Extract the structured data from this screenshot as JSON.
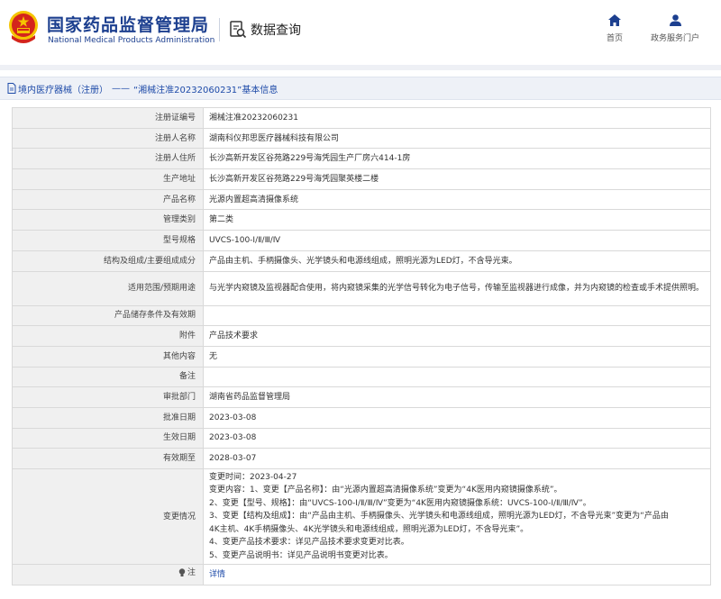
{
  "header": {
    "org_name_cn": "国家药品监督管理局",
    "org_name_en": "National Medical Products Administration",
    "section_title": "数据查询",
    "nav": [
      {
        "label": "首页",
        "icon": "home-icon"
      },
      {
        "label": "政务服务门户",
        "icon": "user-icon"
      }
    ]
  },
  "breadcrumb": {
    "category": "境内医疗器械（注册）",
    "separator": "——",
    "page_title": "“湘械注准20232060231”基本信息"
  },
  "rows": [
    {
      "label": "注册证编号",
      "value": "湘械注准20232060231"
    },
    {
      "label": "注册人名称",
      "value": "湖南科仪邦思医疗器械科技有限公司"
    },
    {
      "label": "注册人住所",
      "value": "长沙高新开发区谷苑路229号海凭园生产厂房六414-1房"
    },
    {
      "label": "生产地址",
      "value": "长沙高新开发区谷苑路229号海凭园聚英楼二楼"
    },
    {
      "label": "产品名称",
      "value": "光源内置超高清摄像系统"
    },
    {
      "label": "管理类别",
      "value": "第二类"
    },
    {
      "label": "型号规格",
      "value": "UVCS-100-Ⅰ/Ⅱ/Ⅲ/Ⅳ"
    },
    {
      "label": "结构及组成/主要组成成分",
      "value": "产品由主机、手柄摄像头、光学镜头和电源线组成，照明光源为LED灯，不含导光束。"
    },
    {
      "label": "适用范围/预期用途",
      "value": "与光学内窥镜及监视器配合使用，将内窥镜采集的光学信号转化为电子信号，传输至监视器进行成像，并为内窥镜的检查或手术提供照明。"
    },
    {
      "label": "产品储存条件及有效期",
      "value": ""
    },
    {
      "label": "附件",
      "value": "产品技术要求"
    },
    {
      "label": "其他内容",
      "value": "无"
    },
    {
      "label": "备注",
      "value": ""
    },
    {
      "label": "审批部门",
      "value": "湖南省药品监督管理局"
    },
    {
      "label": "批准日期",
      "value": "2023-03-08"
    },
    {
      "label": "生效日期",
      "value": "2023-03-08"
    },
    {
      "label": "有效期至",
      "value": "2028-03-07"
    }
  ],
  "changes": {
    "label": "变更情况",
    "lines": [
      "变更时间：2023-04-27",
      "变更内容：1、变更【产品名称】：由“光源内置超高清摄像系统”变更为“4K医用内窥镜摄像系统”。",
      "2、变更【型号、规格】：由“UVCS-100-Ⅰ/Ⅱ/Ⅲ/Ⅳ”变更为“4K医用内窥镜摄像系统：UVCS-100-Ⅰ/Ⅱ/Ⅲ/Ⅳ”。",
      "3、变更【结构及组成】：由“产品由主机、手柄摄像头、光学镜头和电源线组成，照明光源为LED灯，不含导光束”变更为“产品由",
      "4K主机、4K手柄摄像头、4K光学镜头和电源线组成，照明光源为LED灯，不含导光束”。",
      "4、变更产品技术要求：详见产品技术要求变更对比表。",
      "5、变更产品说明书：详见产品说明书变更对比表。"
    ]
  },
  "footer_row": {
    "label": "注",
    "icon": "lightbulb-icon",
    "link": "详情"
  },
  "colors": {
    "brand_blue": "#1c3f8f",
    "link_blue": "#1d4aa8",
    "label_bg": "#f0f0f0",
    "emblem_red": "#d4251c",
    "emblem_gold": "#f5c400"
  }
}
